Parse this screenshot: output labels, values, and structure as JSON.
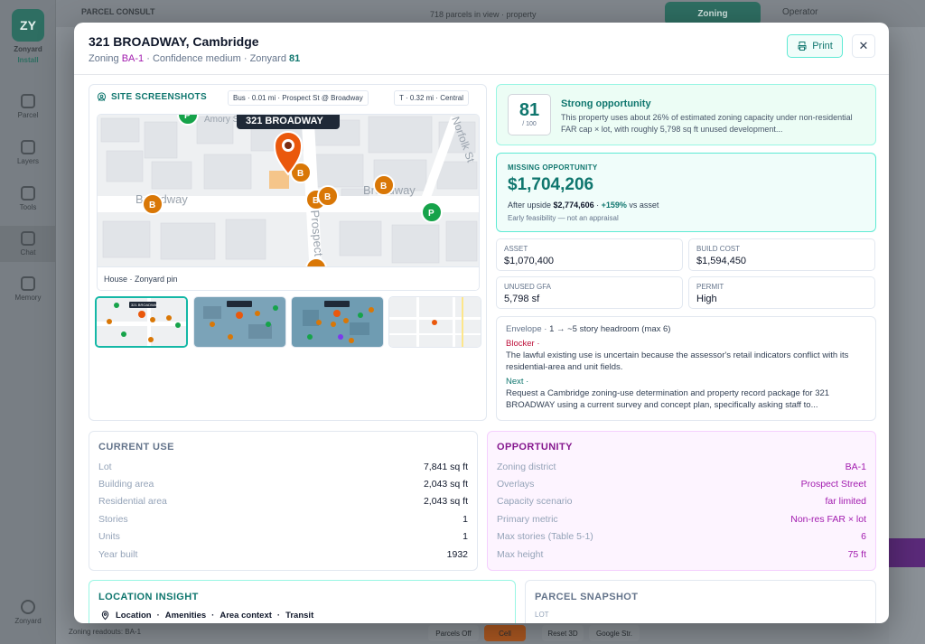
{
  "background": {
    "logo": "ZY",
    "brand": "Zonyard",
    "brand_sub": "Install",
    "rail": [
      "Parcel",
      "Layers",
      "Tools",
      "Chat",
      "Memory"
    ],
    "rail_bottom": "Zonyard",
    "topbar_title": "PARCEL CONSULT",
    "topbar_parcels": "718 parcels in view · property",
    "zoning_tab": "Zoning",
    "operator_tab": "Operator",
    "bottom_text": "Zoning readouts: BA-1",
    "bottom_buttons": [
      "Parcels Off",
      "Cell",
      "Reset 3D",
      "Google Str."
    ]
  },
  "modal": {
    "title": "321 BROADWAY, Cambridge",
    "subtitle": {
      "zoning_label": "Zoning",
      "zoning_value": "BA-1",
      "confidence_label": "· Confidence",
      "confidence_value": "medium",
      "zonyard_label": "· Zonyard",
      "zonyard_value": "81"
    },
    "print_label": "Print",
    "close_label": "✕"
  },
  "site": {
    "title": "SITE SCREENSHOTS",
    "chips": [
      "Bus · 0.01 mi · Prospect St @ Broadway",
      "T · 0.32 mi · Central"
    ],
    "map_pin_label": "321 BROADWAY",
    "map_streets": [
      "Broadway",
      "Broadway",
      "Prospect St",
      "Norfolk St",
      "Amory St"
    ],
    "caption": "House · Zonyard pin",
    "thumb_label": "321 BROADWAY"
  },
  "score": {
    "value": "81",
    "denominator": "/ 100",
    "heading": "Strong opportunity",
    "text": "This property uses about 26% of estimated zoning capacity under non-residential FAR cap × lot, with roughly 5,798 sq ft unused development..."
  },
  "missing": {
    "label": "MISSING OPPORTUNITY",
    "value": "$1,704,206",
    "after_prefix": "After upside",
    "after_value": "$2,774,606",
    "after_sep": "·",
    "pct": "+159%",
    "after_suffix": "vs asset",
    "note": "Early feasibility — not an appraisal"
  },
  "stats": [
    {
      "label": "ASSET",
      "value": "$1,070,400"
    },
    {
      "label": "BUILD COST",
      "value": "$1,594,450"
    },
    {
      "label": "UNUSED GFA",
      "value": "5,798 sf"
    },
    {
      "label": "PERMIT",
      "value": "High"
    }
  ],
  "notes": {
    "envelope_label": "Envelope ·",
    "envelope_text": "1 → ~5 story headroom (max 6)",
    "blocker_label": "Blocker ·",
    "blocker_text": "The lawful existing use is uncertain because the assessor's retail indicators conflict with its residential-area and unit fields.",
    "next_label": "Next ·",
    "next_text": "Request a Cambridge zoning-use determination and property record package for 321 BROADWAY using a current survey and concept plan, specifically asking staff to..."
  },
  "current_use": {
    "title": "CURRENT USE",
    "rows": [
      {
        "label": "Lot",
        "value": "7,841 sq ft"
      },
      {
        "label": "Building area",
        "value": "2,043 sq ft"
      },
      {
        "label": "Residential area",
        "value": "2,043 sq ft"
      },
      {
        "label": "Stories",
        "value": "1"
      },
      {
        "label": "Units",
        "value": "1"
      },
      {
        "label": "Year built",
        "value": "1932"
      }
    ]
  },
  "opportunity": {
    "title": "OPPORTUNITY",
    "rows": [
      {
        "label": "Zoning district",
        "value": "BA-1"
      },
      {
        "label": "Overlays",
        "value": "Prospect Street"
      },
      {
        "label": "Capacity scenario",
        "value": "far limited"
      },
      {
        "label": "Primary metric",
        "value": "Non-res FAR × lot"
      },
      {
        "label": "Max stories (Table 5-1)",
        "value": "6"
      },
      {
        "label": "Max height",
        "value": "75 ft"
      }
    ]
  },
  "location": {
    "title": "LOCATION INSIGHT",
    "tabs": [
      "Location",
      "Amenities",
      "Area context",
      "Transit"
    ],
    "sep": "·"
  },
  "snapshot": {
    "title": "PARCEL SNAPSHOT",
    "lot_label": "LOT"
  },
  "colors": {
    "accent": "#0f766e",
    "purple": "#a21caf",
    "pin": "#ea580c",
    "bus_marker": "#d97706",
    "parking_marker": "#16a34a"
  }
}
